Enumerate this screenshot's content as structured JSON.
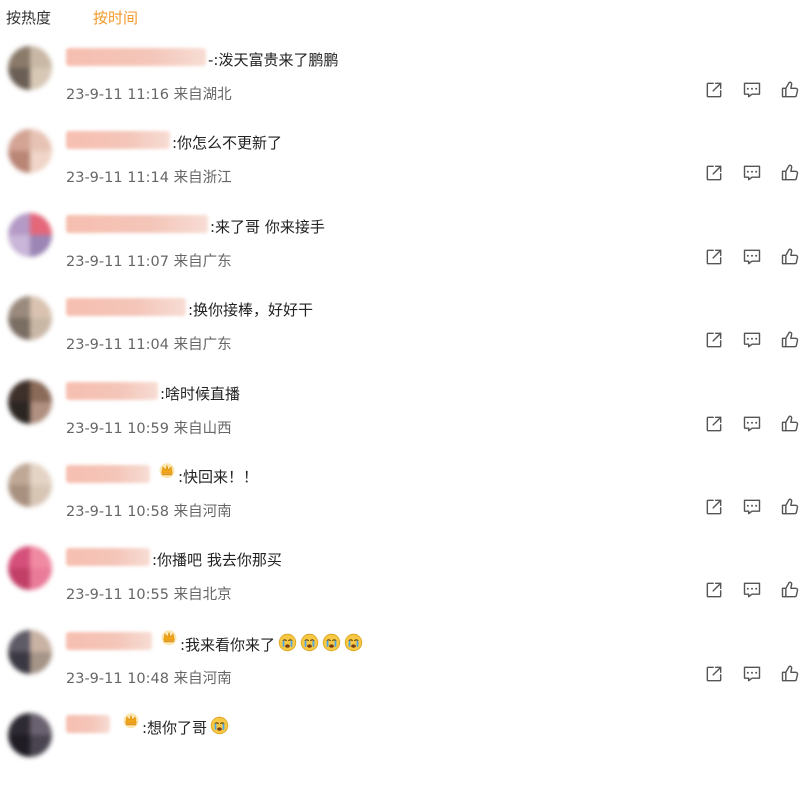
{
  "sort_tabs": {
    "hot": "按热度",
    "time": "按时间",
    "active": "time"
  },
  "comments": [
    {
      "text": "-:泼天富贵来了鹏鹏",
      "time": "23-9-11 11:16",
      "location": "来自湖北",
      "crown": false,
      "emoji_count": 0
    },
    {
      "text": ":你怎么不更新了",
      "time": "23-9-11 11:14",
      "location": "来自浙江",
      "crown": false,
      "emoji_count": 0
    },
    {
      "text": ":来了哥 你来接手",
      "time": "23-9-11 11:07",
      "location": "来自广东",
      "crown": false,
      "emoji_count": 0
    },
    {
      "text": ":换你接棒，好好干",
      "time": "23-9-11 11:04",
      "location": "来自广东",
      "crown": false,
      "emoji_count": 0
    },
    {
      "text": ":啥时候直播",
      "time": "23-9-11 10:59",
      "location": "来自山西",
      "crown": false,
      "emoji_count": 0
    },
    {
      "text": ":快回来！！",
      "time": "23-9-11 10:58",
      "location": "来自河南",
      "crown": true,
      "emoji_count": 0
    },
    {
      "text": ":你播吧 我去你那买",
      "time": "23-9-11 10:55",
      "location": "来自北京",
      "crown": false,
      "emoji_count": 0
    },
    {
      "text": ":我来看你来了",
      "time": "23-9-11 10:48",
      "location": "来自河南",
      "crown": true,
      "emoji_count": 4
    },
    {
      "text": ":想你了哥",
      "time": "",
      "location": "",
      "crown": true,
      "emoji_count": 1
    }
  ],
  "icons": {
    "share": "share-icon",
    "reply": "comment-icon",
    "like": "thumbs-up-icon",
    "crown": "crown-icon",
    "emoji": "crying-face-icon"
  },
  "colors": {
    "active_tab": "#f39a2b",
    "meta_text": "#666666",
    "icon": "#555555"
  }
}
